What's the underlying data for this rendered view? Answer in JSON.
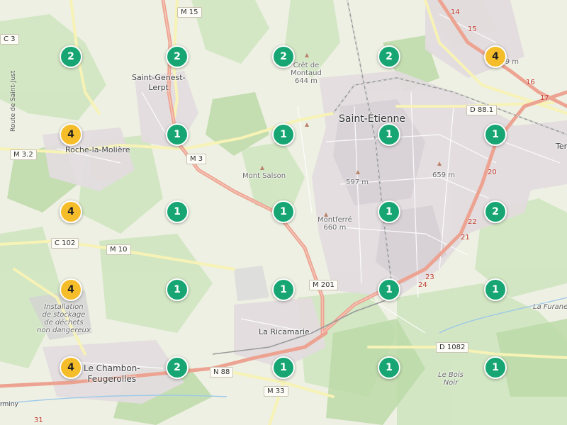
{
  "colors": {
    "cluster_green": "#17a673",
    "cluster_yellow": "#f6bd2b",
    "cluster_text_light": "#ffffff",
    "cluster_text_dark": "#222222"
  },
  "places": {
    "saint_etienne": "Saint-Étienne",
    "saint_genest_1": "Saint-Genest-",
    "saint_genest_2": "Lerpt",
    "roche": "Roche-la-Molière",
    "la_ricamarie": "La Ricamarie",
    "chambon_1": "Le Chambon-",
    "chambon_2": "Feugerolles",
    "mont_salson": "Mont Salson",
    "cret_1": "Crêt de",
    "cret_2": "Montaud",
    "cret_3": "644 m",
    "montferre_1": "Montferré",
    "montferre_2": "660 m",
    "elev_597": "597 m",
    "elev_659": "659 m",
    "elev_589": "589 m",
    "installation_1": "Installation",
    "installation_2": "de stockage",
    "installation_3": "de déchets",
    "installation_4": "non dangereux",
    "le_bois_1": "Le Bois",
    "le_bois_2": "Noir",
    "route_saint_just": "Route de Saint-Just",
    "ter": "Ter",
    "la_furane": "La Furane",
    "firminy": "rminy"
  },
  "roads": {
    "m15": "M 15",
    "m3": "M 3",
    "m3_2": "M 3.2",
    "c3": "C 3",
    "c102": "C 102",
    "m10": "M 10",
    "m201": "M 201",
    "n88": "N 88",
    "m33": "M 33",
    "d88_1": "D 88.1",
    "d1082": "D 1082"
  },
  "road_numbers": {
    "n14": "14",
    "n15": "15",
    "n16": "16",
    "n17": "17",
    "n20": "20",
    "n21": "21",
    "n22": "22",
    "n23": "23",
    "n24": "24",
    "n31": "31"
  },
  "clusters": [
    {
      "count": "2",
      "level": "green"
    },
    {
      "count": "2",
      "level": "green"
    },
    {
      "count": "2",
      "level": "green"
    },
    {
      "count": "2",
      "level": "green"
    },
    {
      "count": "4",
      "level": "yellow"
    },
    {
      "count": "4",
      "level": "yellow"
    },
    {
      "count": "1",
      "level": "green"
    },
    {
      "count": "1",
      "level": "green"
    },
    {
      "count": "1",
      "level": "green"
    },
    {
      "count": "1",
      "level": "green"
    },
    {
      "count": "4",
      "level": "yellow"
    },
    {
      "count": "1",
      "level": "green"
    },
    {
      "count": "1",
      "level": "green"
    },
    {
      "count": "1",
      "level": "green"
    },
    {
      "count": "2",
      "level": "green"
    },
    {
      "count": "4",
      "level": "yellow"
    },
    {
      "count": "1",
      "level": "green"
    },
    {
      "count": "1",
      "level": "green"
    },
    {
      "count": "1",
      "level": "green"
    },
    {
      "count": "1",
      "level": "green"
    },
    {
      "count": "4",
      "level": "yellow"
    },
    {
      "count": "2",
      "level": "green"
    },
    {
      "count": "1",
      "level": "green"
    },
    {
      "count": "1",
      "level": "green"
    },
    {
      "count": "1",
      "level": "green"
    }
  ]
}
